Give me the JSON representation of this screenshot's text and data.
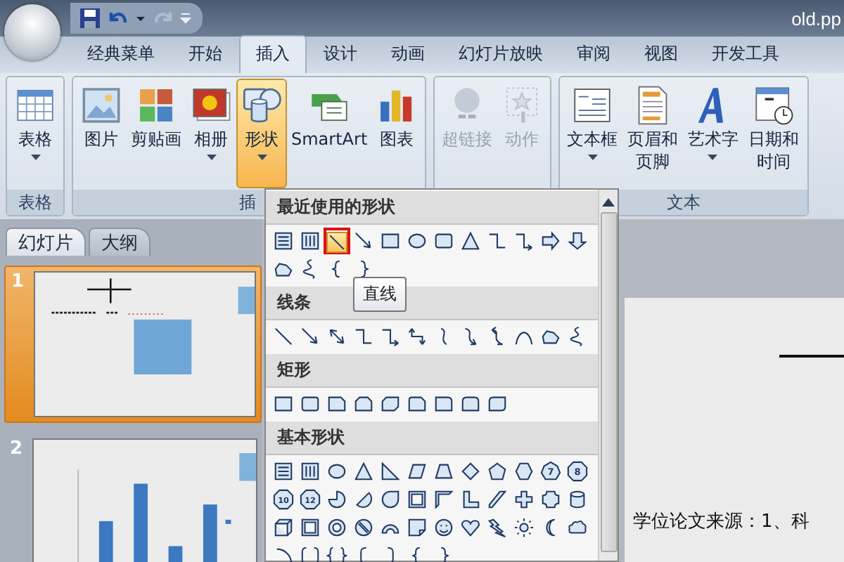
{
  "window": {
    "title": "old.pp"
  },
  "quick_access": [
    {
      "kind": "save",
      "disabled": false
    },
    {
      "kind": "undo",
      "disabled": false
    },
    {
      "kind": "caret",
      "disabled": false
    },
    {
      "kind": "redo",
      "disabled": true
    },
    {
      "kind": "customize",
      "disabled": false
    }
  ],
  "tabs": [
    {
      "label": "经典菜单",
      "selected": false
    },
    {
      "label": "开始",
      "selected": false
    },
    {
      "label": "插入",
      "selected": true
    },
    {
      "label": "设计",
      "selected": false
    },
    {
      "label": "动画",
      "selected": false
    },
    {
      "label": "幻灯片放映",
      "selected": false
    },
    {
      "label": "审阅",
      "selected": false
    },
    {
      "label": "视图",
      "selected": false
    },
    {
      "label": "开发工具",
      "selected": false
    }
  ],
  "ribbon": {
    "groups": [
      {
        "label": "表格",
        "buttons": [
          {
            "kind": "table",
            "label": "表格",
            "dropdown": true,
            "disabled": false,
            "selected": false
          }
        ]
      },
      {
        "label": "插",
        "buttons": [
          {
            "kind": "picture",
            "label": "图片",
            "dropdown": false,
            "disabled": false,
            "selected": false
          },
          {
            "kind": "clipart",
            "label": "剪贴画",
            "dropdown": false,
            "disabled": false,
            "selected": false
          },
          {
            "kind": "album",
            "label": "相册",
            "dropdown": true,
            "disabled": false,
            "selected": false
          },
          {
            "kind": "shapes",
            "label": "形状",
            "dropdown": true,
            "disabled": false,
            "selected": true
          },
          {
            "kind": "smartart",
            "label": "SmartArt",
            "dropdown": false,
            "disabled": false,
            "selected": false
          },
          {
            "kind": "chart",
            "label": "图表",
            "dropdown": false,
            "disabled": false,
            "selected": false
          }
        ]
      },
      {
        "buttons": [
          {
            "kind": "hyperlink",
            "label": "超链接",
            "dropdown": false,
            "disabled": true,
            "selected": false
          },
          {
            "kind": "action",
            "label": "动作",
            "dropdown": false,
            "disabled": true,
            "selected": false
          }
        ]
      },
      {
        "label": "文本",
        "buttons": [
          {
            "kind": "textbox",
            "label": "文本框",
            "dropdown": true,
            "disabled": false,
            "selected": false
          },
          {
            "kind": "header",
            "label": "页眉和页脚",
            "dropdown": false,
            "disabled": false,
            "selected": false
          },
          {
            "kind": "wordart",
            "label": "艺术字",
            "dropdown": true,
            "disabled": false,
            "selected": false
          },
          {
            "kind": "datetime",
            "label": "日期和时间",
            "dropdown": false,
            "disabled": false,
            "selected": false
          }
        ]
      }
    ]
  },
  "pane_tabs": [
    {
      "label": "幻灯片",
      "selected": true
    },
    {
      "label": "大纲",
      "selected": false
    }
  ],
  "slides": [
    {
      "number": "1",
      "kind": "shapes",
      "selected": true
    },
    {
      "number": "2",
      "kind": "chart",
      "selected": false
    }
  ],
  "slide": {
    "text": "学位论文来源：1、科"
  },
  "shapes_menu": {
    "tooltip": "直线",
    "sections": [
      {
        "title": "最近使用的形状",
        "shapes": [
          {
            "kind": "textbox",
            "selected": false
          },
          {
            "kind": "vtextbox",
            "selected": false
          },
          {
            "kind": "line",
            "selected": true
          },
          {
            "kind": "arrow",
            "selected": false
          },
          {
            "kind": "rect",
            "selected": false
          },
          {
            "kind": "oval",
            "selected": false
          },
          {
            "kind": "roundrect",
            "selected": false
          },
          {
            "kind": "triangle",
            "selected": false
          },
          {
            "kind": "elbow",
            "selected": false
          },
          {
            "kind": "elbowarrow",
            "selected": false
          },
          {
            "kind": "rightarrow",
            "selected": false
          },
          {
            "kind": "downarrow",
            "selected": false
          },
          {
            "kind": "freeform",
            "selected": false
          },
          {
            "kind": "scribble",
            "selected": false
          },
          {
            "kind": "lbrace",
            "selected": false
          },
          {
            "kind": "rbrace",
            "selected": false
          }
        ]
      },
      {
        "title": "线条",
        "shapes": [
          {
            "kind": "line",
            "selected": false
          },
          {
            "kind": "arrow",
            "selected": false
          },
          {
            "kind": "doublearrow",
            "selected": false
          },
          {
            "kind": "elbow",
            "selected": false
          },
          {
            "kind": "elbowarrow",
            "selected": false
          },
          {
            "kind": "elbowdouble",
            "selected": false
          },
          {
            "kind": "curve",
            "selected": false
          },
          {
            "kind": "curvearrow",
            "selected": false
          },
          {
            "kind": "curvedouble",
            "selected": false
          },
          {
            "kind": "arcline",
            "selected": false
          },
          {
            "kind": "freeform",
            "selected": false
          },
          {
            "kind": "scribble",
            "selected": false
          }
        ]
      },
      {
        "title": "矩形",
        "shapes": [
          {
            "kind": "rect",
            "selected": false
          },
          {
            "kind": "roundrect",
            "selected": false
          },
          {
            "kind": "snip",
            "selected": false
          },
          {
            "kind": "snip2",
            "selected": false
          },
          {
            "kind": "snipdiag",
            "selected": false
          },
          {
            "kind": "sniprnd",
            "selected": false
          },
          {
            "kind": "round1",
            "selected": false
          },
          {
            "kind": "round2",
            "selected": false
          },
          {
            "kind": "rounddiag",
            "selected": false
          }
        ]
      },
      {
        "title": "基本形状",
        "shapes": [
          {
            "kind": "textbox",
            "selected": false
          },
          {
            "kind": "vtextbox",
            "selected": false
          },
          {
            "kind": "oval",
            "selected": false
          },
          {
            "kind": "triangle",
            "selected": false
          },
          {
            "kind": "rtriangle",
            "selected": false
          },
          {
            "kind": "parallelogram",
            "selected": false
          },
          {
            "kind": "trapezoid",
            "selected": false
          },
          {
            "kind": "diamond",
            "selected": false
          },
          {
            "kind": "pentagon",
            "selected": false
          },
          {
            "kind": "hexagon",
            "selected": false
          },
          {
            "kind": "heptagon",
            "label": "7",
            "selected": false
          },
          {
            "kind": "octagon",
            "label": "8",
            "selected": false
          },
          {
            "kind": "decagon",
            "label": "10",
            "selected": false
          },
          {
            "kind": "dodecagon",
            "label": "12",
            "selected": false
          },
          {
            "kind": "pie",
            "selected": false
          },
          {
            "kind": "chord",
            "selected": false
          },
          {
            "kind": "teardrop",
            "selected": false
          },
          {
            "kind": "frame",
            "selected": false
          },
          {
            "kind": "halfframe",
            "selected": false
          },
          {
            "kind": "lshape",
            "selected": false
          },
          {
            "kind": "diagstripe",
            "selected": false
          },
          {
            "kind": "cross",
            "selected": false
          },
          {
            "kind": "plaque",
            "selected": false
          },
          {
            "kind": "can",
            "selected": false
          },
          {
            "kind": "cube",
            "selected": false
          },
          {
            "kind": "bevel",
            "selected": false
          },
          {
            "kind": "donut",
            "selected": false
          },
          {
            "kind": "nosymbol",
            "selected": false
          },
          {
            "kind": "blockarc",
            "selected": false
          },
          {
            "kind": "foldedcorner",
            "selected": false
          },
          {
            "kind": "smiley",
            "selected": false
          },
          {
            "kind": "heart",
            "selected": false
          },
          {
            "kind": "lightning",
            "selected": false
          },
          {
            "kind": "sun",
            "selected": false
          },
          {
            "kind": "moon",
            "selected": false
          },
          {
            "kind": "cloud",
            "selected": false
          },
          {
            "kind": "arc",
            "selected": false
          },
          {
            "kind": "bracketpair",
            "selected": false
          },
          {
            "kind": "bracepair",
            "selected": false
          },
          {
            "kind": "lbracket",
            "selected": false
          },
          {
            "kind": "rbracket",
            "selected": false
          },
          {
            "kind": "lbrace",
            "selected": false
          },
          {
            "kind": "rbrace",
            "selected": false
          }
        ]
      }
    ]
  }
}
